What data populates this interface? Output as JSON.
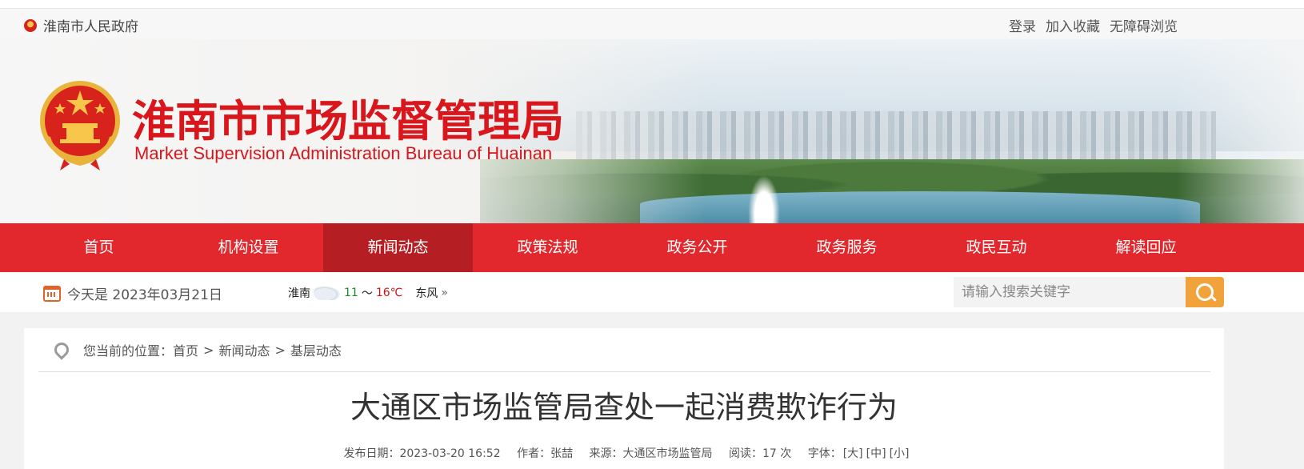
{
  "topbar": {
    "site_name": "淮南市人民政府",
    "links": [
      "登录",
      "加入收藏",
      "无障碍浏览"
    ]
  },
  "banner": {
    "title_cn": "淮南市市场监督管理局",
    "title_en": "Market Supervision Administration Bureau of Huainan"
  },
  "nav": {
    "items": [
      "首页",
      "机构设置",
      "新闻动态",
      "政策法规",
      "政务公开",
      "政务服务",
      "政民互动",
      "解读回应"
    ],
    "active": "新闻动态"
  },
  "infobar": {
    "date": "今天是 2023年03月21日",
    "weather_city": "淮南",
    "temp_low": "11",
    "temp_sep": "～",
    "temp_high": "16℃",
    "wind": "东风",
    "wind_more": "»",
    "search_placeholder": "请输入搜索关键字"
  },
  "breadcrumb": {
    "prefix": "您当前的位置：",
    "items": [
      "首页",
      "新闻动态",
      "基层动态"
    ],
    "sep": ">"
  },
  "article": {
    "title": "大通区市场监管局查处一起消费欺诈行为",
    "publish_date": "发布日期：2023-03-20 16:52",
    "author": "作者：张喆",
    "source": "来源：大通区市场监管局",
    "reads": "阅读：17 次",
    "font_label": "字体：",
    "font_sizes": [
      "[大]",
      "[中]",
      "[小]"
    ]
  },
  "colors": {
    "brand_red": "#e2282c",
    "nav_active": "#b51e22",
    "search_button": "#f2a23a"
  }
}
